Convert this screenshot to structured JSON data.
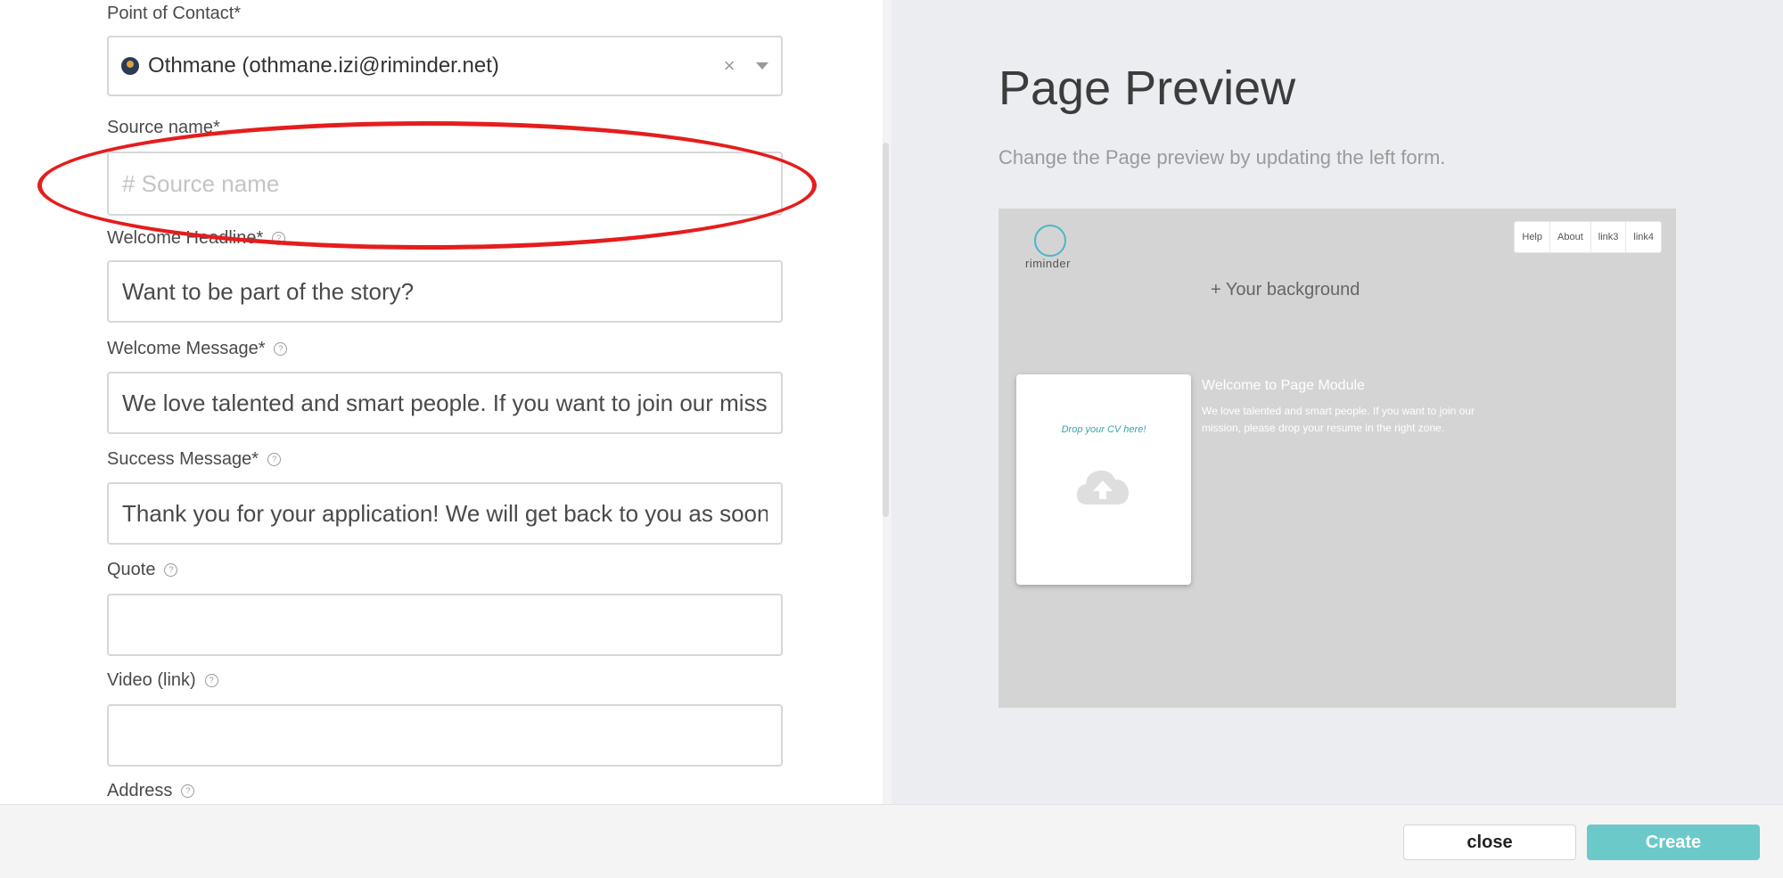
{
  "form": {
    "point_of_contact": {
      "label": "Point of Contact*",
      "value": "Othmane (othmane.izi@riminder.net)",
      "clear": "×"
    },
    "source_name": {
      "label": "Source name*",
      "placeholder": "# Source name",
      "value": ""
    },
    "welcome_headline": {
      "label": "Welcome Headline*",
      "value": "Want to be part of the story?"
    },
    "welcome_message": {
      "label": "Welcome Message*",
      "value": "We love talented and smart people. If you want to join our miss"
    },
    "success_message": {
      "label": "Success Message*",
      "value": "Thank you for your application! We will get back to you as soon"
    },
    "quote": {
      "label": "Quote",
      "value": ""
    },
    "video": {
      "label": "Video (link)",
      "value": ""
    },
    "address": {
      "label": "Address"
    },
    "help_glyph": "?"
  },
  "preview": {
    "title": "Page Preview",
    "subtitle": "Change the Page preview by updating the left form.",
    "logo_text": "riminder",
    "nav": [
      "Help",
      "About",
      "link3",
      "link4"
    ],
    "background_label": "+ Your background",
    "card_text": "Drop your CV here!",
    "welcome_title": "Welcome to Page Module",
    "welcome_message": "We love talented and smart people. If you want to join our mission, please drop your resume in the right zone."
  },
  "footer": {
    "close_label": "close",
    "create_label": "Create"
  },
  "colors": {
    "accent": "#6bc9c9",
    "annotation": "#e51d1d",
    "logo": "#49b7c9"
  }
}
